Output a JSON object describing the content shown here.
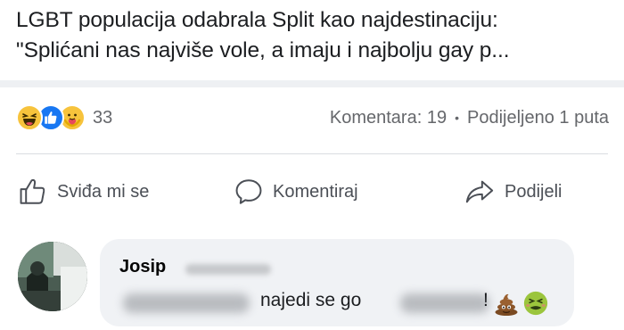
{
  "post": {
    "title_line1": "LGBT populacija odabrala Split kao najdestinaciju:",
    "title_line2": "\"Splićani nas najviše vole, a imaju i najbolju gay p..."
  },
  "stats": {
    "reactions": [
      "haha-icon",
      "like-icon",
      "care-icon"
    ],
    "reaction_count": "33",
    "comments_label": "Komentara: 19",
    "separator": "•",
    "shares_label": "Podijeljeno 1 puta"
  },
  "actions": {
    "like_label": "Sviđa mi se",
    "comment_label": "Komentiraj",
    "share_label": "Podijeli"
  },
  "comment": {
    "author": "Josip",
    "text": "najedi se go",
    "suffix": "!",
    "emojis": [
      "poop-emoji",
      "nauseated-face-emoji"
    ]
  },
  "colors": {
    "text": "#1c1e21",
    "secondary": "#65676b",
    "like_blue": "#1877f2",
    "bubble_bg": "#f0f2f5",
    "divider": "#dadde1"
  }
}
